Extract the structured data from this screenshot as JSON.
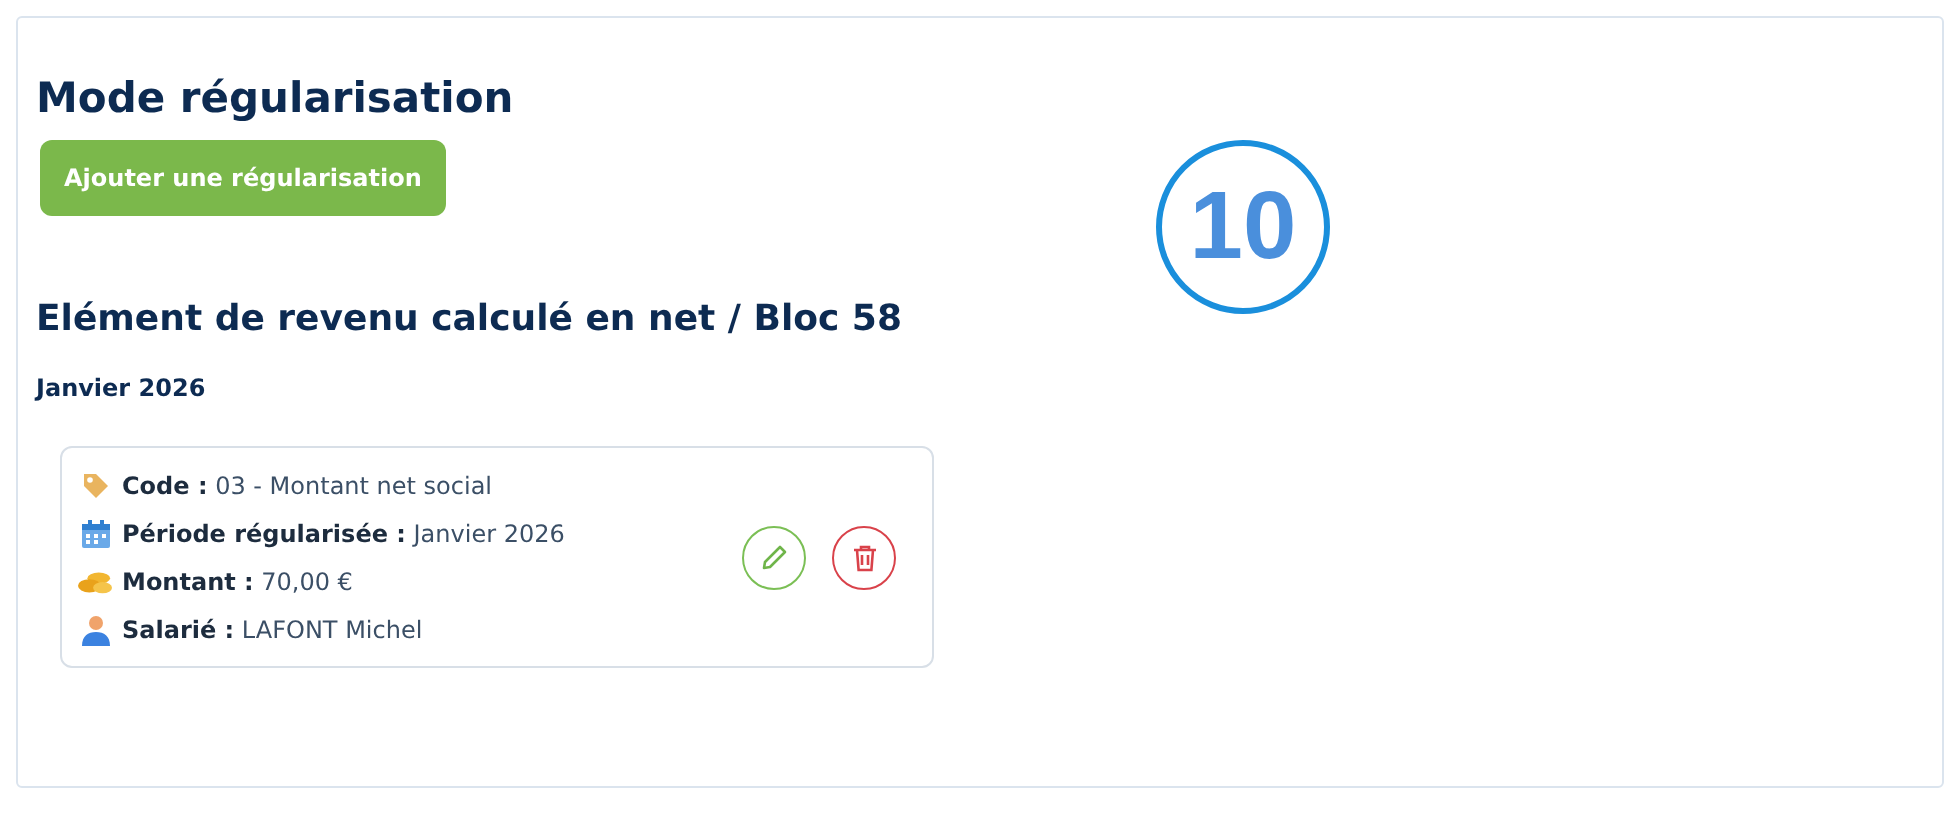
{
  "title": "Mode régularisation",
  "add_button": "Ajouter une régularisation",
  "callout": "10",
  "section_title": "Elément de revenu calculé en net / Bloc 58",
  "month": "Janvier 2026",
  "card": {
    "fields": [
      {
        "kind": "tag",
        "text": "**Code :** 03 - Montant net social"
      },
      {
        "kind": "calendar",
        "text": "**Période régularisée :** Janvier 2026"
      },
      {
        "kind": "coins",
        "text": "**Montant :** 70,00 €"
      },
      {
        "kind": "person",
        "text": "**Salarié :** LAFONT Michel"
      }
    ],
    "actions": [
      {
        "kind": "edit"
      },
      {
        "kind": "delete"
      }
    ]
  }
}
